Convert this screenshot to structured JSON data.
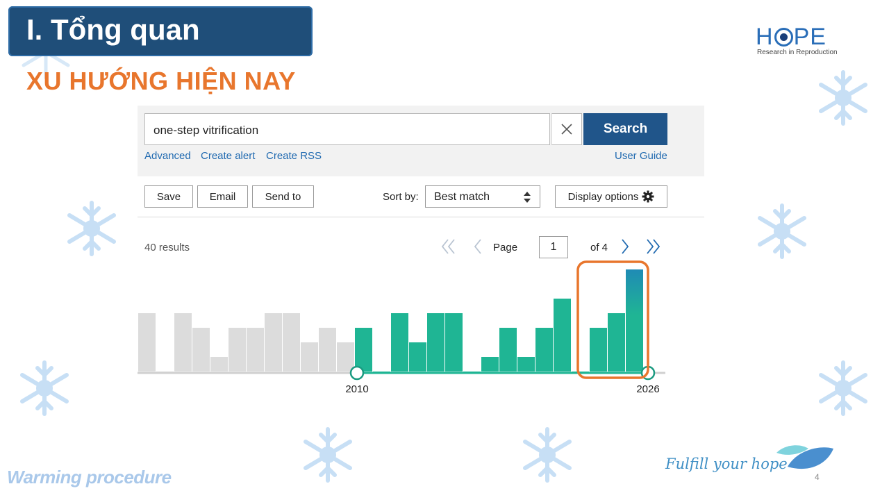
{
  "slide": {
    "title": "I. Tổng quan",
    "subtitle": "XU HƯỚNG HIỆN NAY",
    "logo": {
      "word_left": "H",
      "word_right": "PE",
      "tagline": "Research in Reproduction"
    },
    "footer_left": "Warming procedure",
    "footer_right": "Fulfill your hope",
    "page_number": "4"
  },
  "search": {
    "query": "one-step vitrification",
    "button_label": "Search",
    "links": [
      "Advanced",
      "Create alert",
      "Create RSS"
    ],
    "user_guide": "User Guide"
  },
  "toolbar": {
    "save": "Save",
    "email": "Email",
    "send_to": "Send to",
    "sort_label": "Sort by:",
    "sort_value": "Best match",
    "display_options": "Display options"
  },
  "results": {
    "count_text": "40 results",
    "page_label": "Page",
    "page_value": "1",
    "of_text": "of 4"
  },
  "colors": {
    "title_bg": "#1f4e79",
    "subtitle": "#e8762d",
    "accent_blue": "#20558a",
    "link": "#1f69b0",
    "bar_gray": "#dcdcdc",
    "bar_teal": "#1fb594",
    "highlight_orange": "#e8762d"
  },
  "chart_data": {
    "type": "bar",
    "x_start_label": "2010",
    "x_end_label": "2026",
    "values": [
      4,
      0,
      4,
      3,
      1,
      3,
      3,
      4,
      4,
      2,
      3,
      2,
      3,
      0,
      4,
      2,
      4,
      4,
      0,
      1,
      3,
      1,
      3,
      5,
      0,
      3,
      4,
      7
    ],
    "selected_from_index": 12,
    "highlight_from_index": 24
  }
}
